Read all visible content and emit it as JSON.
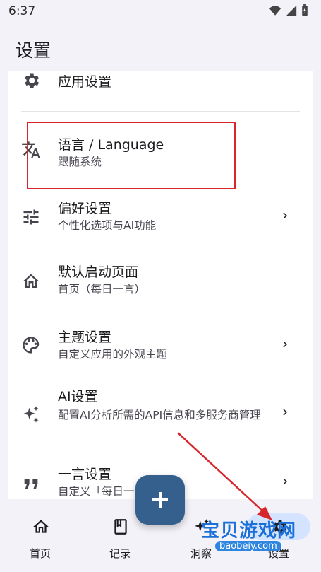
{
  "status": {
    "time": "6:37"
  },
  "appbar": {
    "title": "设置"
  },
  "settings": {
    "items": [
      {
        "title": "应用设置",
        "icon": "gear-icon"
      },
      {
        "title": "语言 / Language",
        "subtitle": "跟随系统",
        "icon": "translate-icon"
      },
      {
        "title": "偏好设置",
        "subtitle": "个性化选项与AI功能",
        "icon": "tune-icon"
      },
      {
        "title": "默认启动页面",
        "subtitle": "首页（每日一言）",
        "icon": "home-icon"
      },
      {
        "title": "主题设置",
        "subtitle": "自定义应用的外观主题",
        "icon": "palette-icon"
      },
      {
        "title": "AI设置",
        "subtitle": "配置AI分析所需的API信息和多服务商管理",
        "icon": "sparkle-icon"
      },
      {
        "title": "一言设置",
        "subtitle": "自定义「每日一言」类型",
        "icon": "quote-icon"
      }
    ]
  },
  "fab": {
    "label": "+"
  },
  "bottom_nav": {
    "items": [
      {
        "label": "首页",
        "icon": "home-icon"
      },
      {
        "label": "记录",
        "icon": "bookmark-book-icon"
      },
      {
        "label": "洞察",
        "icon": "sparkle-icon"
      },
      {
        "label": "设置",
        "icon": "gear-icon",
        "active": true
      }
    ]
  },
  "watermark": {
    "text": "宝贝游戏网",
    "url_text": "baobeiy.com"
  },
  "colors": {
    "accent": "#355f8c",
    "highlight_box": "#d6262c",
    "active_pill": "#d4e3ff"
  }
}
